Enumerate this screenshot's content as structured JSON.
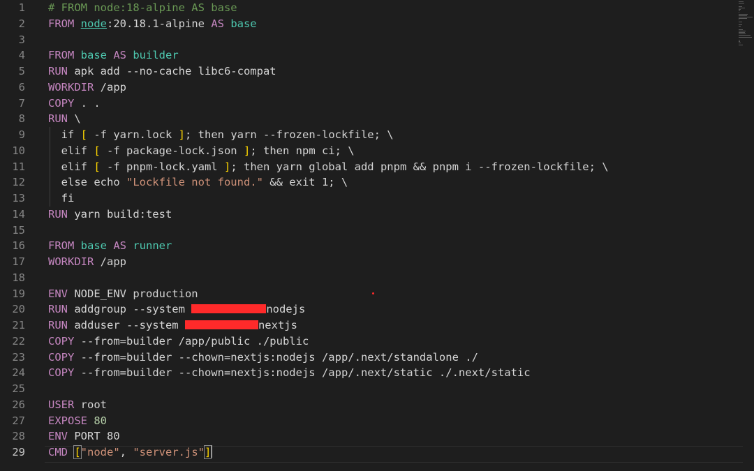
{
  "editor": {
    "current_line": 29,
    "lines": [
      {
        "n": "1",
        "tokens": [
          {
            "t": "# FROM node:18-alpine AS base",
            "c": "comment"
          }
        ]
      },
      {
        "n": "2",
        "tokens": [
          {
            "t": "FROM ",
            "c": "kw"
          },
          {
            "t": "node",
            "c": "id",
            "link": true
          },
          {
            "t": ":20.18.1-alpine ",
            "c": "plain"
          },
          {
            "t": "AS ",
            "c": "kw"
          },
          {
            "t": "base",
            "c": "id"
          }
        ]
      },
      {
        "n": "3",
        "tokens": []
      },
      {
        "n": "4",
        "tokens": [
          {
            "t": "FROM ",
            "c": "kw"
          },
          {
            "t": "base ",
            "c": "id"
          },
          {
            "t": "AS ",
            "c": "kw"
          },
          {
            "t": "builder",
            "c": "id"
          }
        ]
      },
      {
        "n": "5",
        "tokens": [
          {
            "t": "RUN ",
            "c": "kw"
          },
          {
            "t": "apk add --no-cache libc6-compat",
            "c": "plain"
          }
        ]
      },
      {
        "n": "6",
        "tokens": [
          {
            "t": "WORKDIR ",
            "c": "kw"
          },
          {
            "t": "/app",
            "c": "plain"
          }
        ]
      },
      {
        "n": "7",
        "tokens": [
          {
            "t": "COPY ",
            "c": "kw"
          },
          {
            "t": ". .",
            "c": "plain"
          }
        ]
      },
      {
        "n": "8",
        "tokens": [
          {
            "t": "RUN ",
            "c": "kw"
          },
          {
            "t": "\\",
            "c": "plain"
          }
        ]
      },
      {
        "n": "9",
        "tokens": [
          {
            "t": "  if ",
            "c": "plain"
          },
          {
            "t": "[",
            "c": "brk"
          },
          {
            "t": " -f yarn.lock ",
            "c": "plain"
          },
          {
            "t": "]",
            "c": "brk"
          },
          {
            "t": "; then yarn --frozen-lockfile; \\",
            "c": "plain"
          }
        ]
      },
      {
        "n": "10",
        "tokens": [
          {
            "t": "  elif ",
            "c": "plain"
          },
          {
            "t": "[",
            "c": "brk"
          },
          {
            "t": " -f package-lock.json ",
            "c": "plain"
          },
          {
            "t": "]",
            "c": "brk"
          },
          {
            "t": "; then npm ci; \\",
            "c": "plain"
          }
        ]
      },
      {
        "n": "11",
        "tokens": [
          {
            "t": "  elif ",
            "c": "plain"
          },
          {
            "t": "[",
            "c": "brk"
          },
          {
            "t": " -f pnpm-lock.yaml ",
            "c": "plain"
          },
          {
            "t": "]",
            "c": "brk"
          },
          {
            "t": "; then yarn global add pnpm && pnpm i --frozen-lockfile; \\",
            "c": "plain"
          }
        ]
      },
      {
        "n": "12",
        "tokens": [
          {
            "t": "  else echo ",
            "c": "plain"
          },
          {
            "t": "\"Lockfile not found.\"",
            "c": "str"
          },
          {
            "t": " && exit 1; \\",
            "c": "plain"
          }
        ]
      },
      {
        "n": "13",
        "tokens": [
          {
            "t": "  fi",
            "c": "plain"
          }
        ]
      },
      {
        "n": "14",
        "tokens": [
          {
            "t": "RUN ",
            "c": "kw"
          },
          {
            "t": "yarn build:test",
            "c": "plain"
          }
        ]
      },
      {
        "n": "15",
        "tokens": []
      },
      {
        "n": "16",
        "tokens": [
          {
            "t": "FROM ",
            "c": "kw"
          },
          {
            "t": "base ",
            "c": "id"
          },
          {
            "t": "AS ",
            "c": "kw"
          },
          {
            "t": "runner",
            "c": "id"
          }
        ]
      },
      {
        "n": "17",
        "tokens": [
          {
            "t": "WORKDIR ",
            "c": "kw"
          },
          {
            "t": "/app",
            "c": "plain"
          }
        ]
      },
      {
        "n": "18",
        "tokens": []
      },
      {
        "n": "19",
        "tokens": [
          {
            "t": "ENV ",
            "c": "kw"
          },
          {
            "t": "NODE_ENV production",
            "c": "plain"
          }
        ]
      },
      {
        "n": "20",
        "tokens": [
          {
            "t": "RUN ",
            "c": "kw"
          },
          {
            "t": "addgroup --system ",
            "c": "plain"
          },
          {
            "redact": 107
          },
          {
            "t": "nodejs",
            "c": "plain"
          }
        ]
      },
      {
        "n": "21",
        "tokens": [
          {
            "t": "RUN ",
            "c": "kw"
          },
          {
            "t": "adduser --system ",
            "c": "plain"
          },
          {
            "redact": 105
          },
          {
            "t": "nextjs",
            "c": "plain"
          }
        ]
      },
      {
        "n": "22",
        "tokens": [
          {
            "t": "COPY ",
            "c": "kw"
          },
          {
            "t": "--from=builder /app/public ./public",
            "c": "plain"
          }
        ]
      },
      {
        "n": "23",
        "tokens": [
          {
            "t": "COPY ",
            "c": "kw"
          },
          {
            "t": "--from=builder --chown=nextjs:nodejs /app/.next/standalone ./",
            "c": "plain"
          }
        ]
      },
      {
        "n": "24",
        "tokens": [
          {
            "t": "COPY ",
            "c": "kw"
          },
          {
            "t": "--from=builder --chown=nextjs:nodejs /app/.next/static ./.next/static",
            "c": "plain"
          }
        ]
      },
      {
        "n": "25",
        "tokens": []
      },
      {
        "n": "26",
        "tokens": [
          {
            "t": "USER ",
            "c": "kw"
          },
          {
            "t": "root",
            "c": "plain"
          }
        ]
      },
      {
        "n": "27",
        "tokens": [
          {
            "t": "EXPOSE ",
            "c": "kw"
          },
          {
            "t": "80",
            "c": "num"
          }
        ]
      },
      {
        "n": "28",
        "tokens": [
          {
            "t": "ENV ",
            "c": "kw"
          },
          {
            "t": "PORT 80",
            "c": "plain"
          }
        ]
      },
      {
        "n": "29",
        "tokens": [
          {
            "t": "CMD ",
            "c": "kw"
          },
          {
            "t": "[",
            "c": "brk",
            "match": true
          },
          {
            "t": "\"node\"",
            "c": "str"
          },
          {
            "t": ", ",
            "c": "plain"
          },
          {
            "t": "\"server.js\"",
            "c": "str"
          },
          {
            "t": "]",
            "c": "brk",
            "match": true
          },
          {
            "cursor": true
          }
        ]
      }
    ]
  },
  "colors": {
    "background": "#1e1e1e",
    "keyword": "#c586c0",
    "identifier": "#4ec9b0",
    "string": "#ce9178",
    "comment": "#6a9955",
    "bracket": "#ffd700",
    "redaction": "#ff2a2a"
  }
}
